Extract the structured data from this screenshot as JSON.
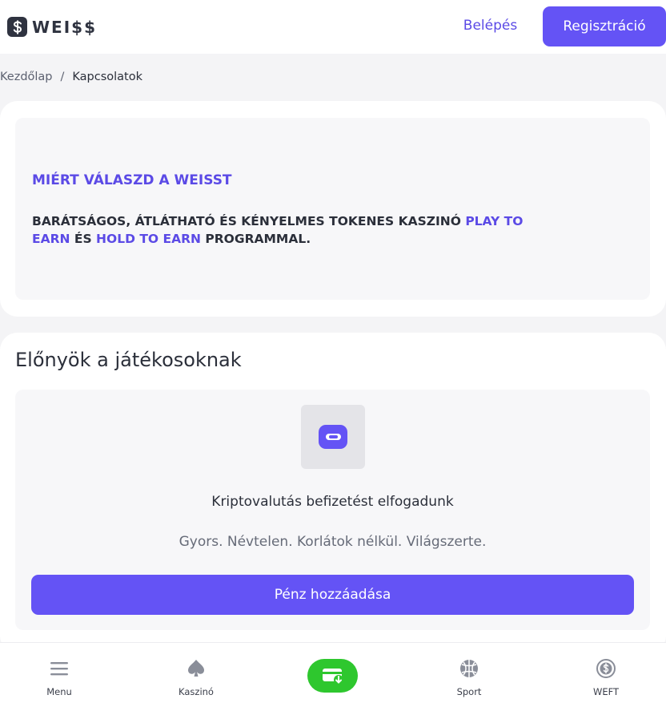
{
  "header": {
    "logo_text": "WEI$$",
    "login_label": "Belépés",
    "register_label": "Regisztráció"
  },
  "breadcrumb": {
    "home": "Kezdőlap",
    "separator": "/",
    "current": "Kapcsolatok"
  },
  "why": {
    "title": "MIÉRT VÁLASZD A WEISST",
    "desc_part1": "BARÁTSÁGOS, ÁTLÁTHATÓ ÉS KÉNYELMES TOKENES KASZINÓ ",
    "desc_hl1": "PLAY TO EARN",
    "desc_part2": " ÉS ",
    "desc_hl2": "HOLD TO EARN",
    "desc_part3": " PROGRAMMAL."
  },
  "benefits": {
    "title": "Előnyök a játékosoknak",
    "icon": "wallet-icon",
    "heading": "Kriptovalutás befizetést elfogadunk",
    "subtext": "Gyors. Névtelen. Korlátok nélkül. Világszerte.",
    "button_label": "Pénz hozzáadása"
  },
  "bottom_nav": {
    "items": [
      {
        "label": "Menu",
        "icon": "menu-icon"
      },
      {
        "label": "Kaszinó",
        "icon": "spade-icon"
      },
      {
        "label": "",
        "icon": "cashier-icon"
      },
      {
        "label": "Sport",
        "icon": "ball-icon"
      },
      {
        "label": "WEFT",
        "icon": "weft-coin-icon"
      }
    ]
  },
  "colors": {
    "accent": "#6453f5",
    "accent_text": "#5b4ae6",
    "cashier_green": "#2ec72e",
    "dark": "#2b2f3a"
  }
}
